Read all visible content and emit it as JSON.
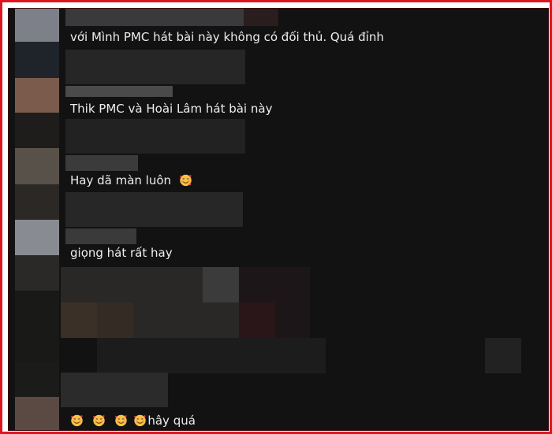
{
  "comments": [
    {
      "text": "với Mình PMC hát bài này không có đối thủ. Quá đỉnh",
      "emojis": []
    },
    {
      "text": "Thik PMC và Hoài Lâm hát bài này",
      "emojis": []
    },
    {
      "text": "Hay dã màn luôn",
      "emojis": [
        "smiling-face-with-hearts"
      ]
    },
    {
      "text": "giọng hát rất hay",
      "emojis": []
    },
    {
      "text": "hây quá",
      "emojis": [
        "smiling-face-with-hearts",
        "smiling-face-with-hearts",
        "smiling-face-with-hearts",
        "smiling-face-with-hearts"
      ]
    }
  ],
  "colors": {
    "frame_border": "#e0141e",
    "background": "#121212",
    "text": "#ededed"
  }
}
